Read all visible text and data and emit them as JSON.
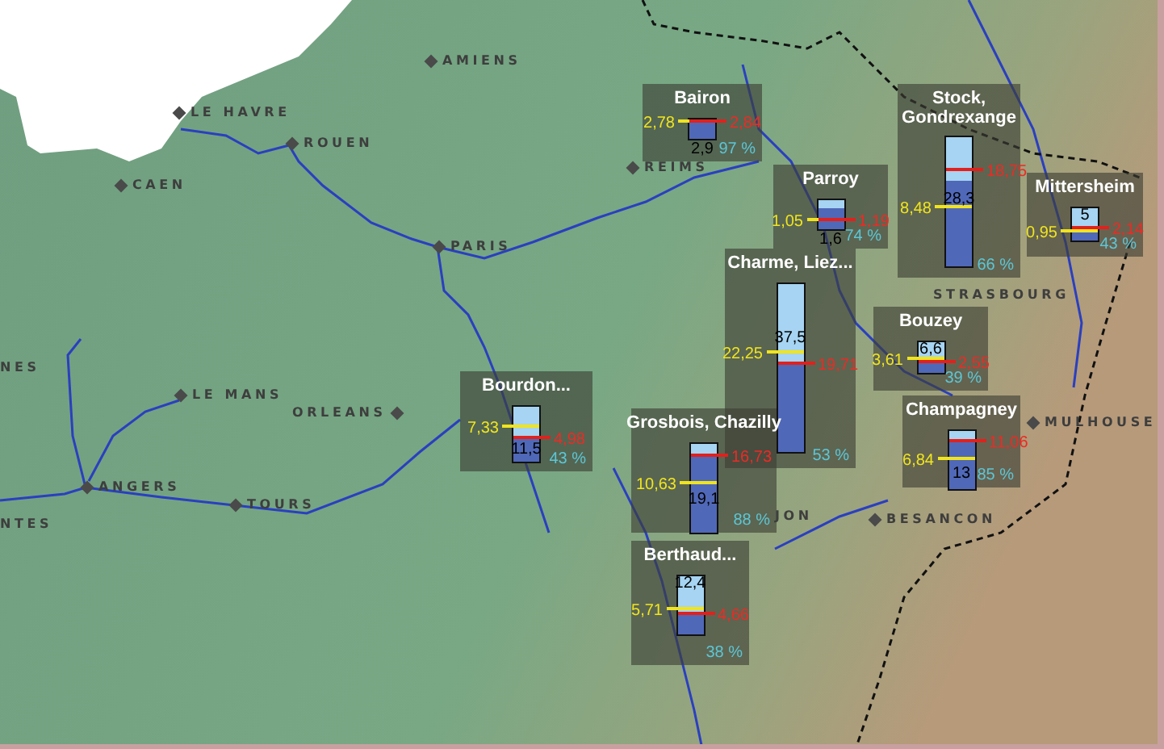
{
  "cities": [
    {
      "name": "AMIENS",
      "kind": "left"
    },
    {
      "name": "LE HAVRE",
      "kind": "left"
    },
    {
      "name": "ROUEN",
      "kind": "left"
    },
    {
      "name": "CAEN",
      "kind": "left"
    },
    {
      "name": "REIMS",
      "kind": "left"
    },
    {
      "name": "PARIS",
      "kind": "left"
    },
    {
      "name": "NES",
      "kind": "plain"
    },
    {
      "name": "LE MANS",
      "kind": "left"
    },
    {
      "name": "ORLEANS",
      "kind": "right"
    },
    {
      "name": "ANGERS",
      "kind": "left"
    },
    {
      "name": "NTES",
      "kind": "plain"
    },
    {
      "name": "TOURS",
      "kind": "left"
    },
    {
      "name": "STRASBOURG",
      "kind": "plain"
    },
    {
      "name": "MULHOUSE",
      "kind": "left"
    },
    {
      "name": "JON",
      "kind": "plain"
    },
    {
      "name": "BESANCON",
      "kind": "left"
    }
  ],
  "reservoirs": [
    {
      "name": "Bairon",
      "level": 0.97,
      "volume": "2,9",
      "percent": "97 %",
      "yellow_marker": {
        "value": "2,78"
      },
      "red_marker": {
        "value": "2,84"
      }
    },
    {
      "name": "Stock, Gondrexange",
      "level": 0.66,
      "volume": "28,3",
      "percent": "66 %",
      "yellow_marker": {
        "value": "8,48",
        "level": 0.47
      },
      "red_marker": {
        "value": "18,75",
        "level": 0.75
      }
    },
    {
      "name": "Parroy",
      "level": 0.74,
      "volume": "1,6",
      "percent": "74 %",
      "yellow_marker": {
        "value": "1,05"
      },
      "red_marker": {
        "value": "1,19"
      }
    },
    {
      "name": "Mittersheim",
      "level": 0.43,
      "volume": "5",
      "percent": "43 %",
      "yellow_marker": {
        "value": "0,95",
        "level": 0.3
      },
      "red_marker": {
        "value": "2,14",
        "level": 0.4
      }
    },
    {
      "name": "Charme, Liez...",
      "level": 0.53,
      "volume": "37,5",
      "percent": "53 %",
      "yellow_marker": {
        "value": "22,25",
        "level": 0.6
      },
      "red_marker": {
        "value": "19,71",
        "level": 0.53
      }
    },
    {
      "name": "Bouzey",
      "level": 0.39,
      "volume": "6,6",
      "percent": "39 %",
      "yellow_marker": {
        "value": "3,61",
        "level": 0.5
      },
      "red_marker": {
        "value": "2,55",
        "level": 0.4
      }
    },
    {
      "name": "Champagney",
      "level": 0.85,
      "volume": "13",
      "percent": "85 %",
      "yellow_marker": {
        "value": "6,84",
        "level": 0.54
      },
      "red_marker": {
        "value": "11,06",
        "level": 0.84
      }
    },
    {
      "name": "Bourdon...",
      "level": 0.43,
      "volume": "11,5",
      "percent": "43 %",
      "yellow_marker": {
        "value": "7,33",
        "level": 0.65
      },
      "red_marker": {
        "value": "4,98",
        "level": 0.44
      }
    },
    {
      "name": "Grosbois, Chazilly",
      "level": 0.88,
      "volume": "19,1",
      "percent": "88 %",
      "yellow_marker": {
        "value": "10,63",
        "level": 0.56
      },
      "red_marker": {
        "value": "16,73",
        "level": 0.87
      }
    },
    {
      "name": "Berthaud...",
      "level": 0.38,
      "volume": "12,4",
      "percent": "38 %",
      "yellow_marker": {
        "value": "5,71",
        "level": 0.46
      },
      "red_marker": {
        "value": "4,66",
        "level": 0.38
      }
    }
  ]
}
